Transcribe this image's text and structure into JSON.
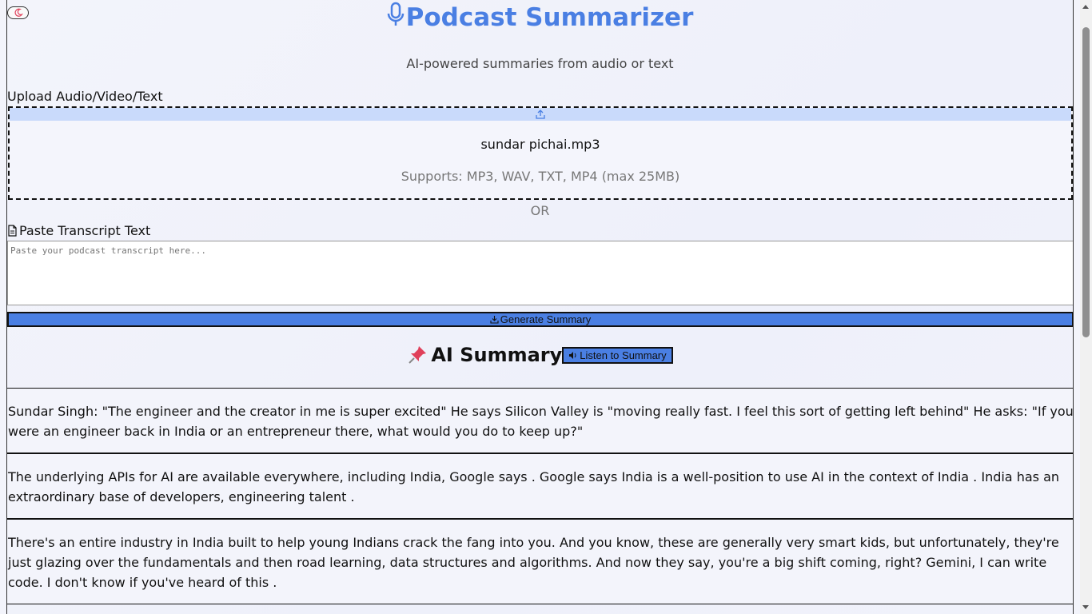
{
  "header": {
    "title": "Podcast Summarizer",
    "subtitle": "AI-powered summaries from audio or text"
  },
  "upload": {
    "label": "Upload Audio/Video/Text",
    "filename": "sundar pichai.mp3",
    "supports": "Supports: MP3, WAV, TXT, MP4 (max 25MB)"
  },
  "or_text": "OR",
  "transcript": {
    "label": "Paste Transcript Text",
    "placeholder": "Paste your podcast transcript here..."
  },
  "generate_button": "Generate Summary",
  "summary": {
    "heading": "AI Summary",
    "listen_button": "Listen to Summary",
    "paragraphs": [
      "Sundar Singh: \"The engineer and the creator in me is super excited\" He says Silicon Valley is \"moving really fast. I feel this sort of getting left behind\" He asks: \"If you were an engineer back in India or an entrepreneur there, what would you do to keep up?\"",
      "The underlying APIs for AI are available everywhere, including India, Google says . Google says India is a well-position to use AI in the context of India . India has an extraordinary base of developers, engineering talent .",
      "There's an entire industry in India built to help young Indians crack the fang into you. And you know, these are generally very smart kids, but unfortunately, they're just glazing over the fundamentals and then road learning, data structures and algorithms. And now they say, you're a big shift coming, right? Gemini, I can write code. I don't know if you've heard of this ."
    ]
  },
  "colors": {
    "accent": "#4a7fe3",
    "dropzone_bar": "#c9dafb",
    "background": "#f3f4fb"
  },
  "icons": {
    "theme": "moon-icon",
    "title": "microphone-icon",
    "upload": "upload-icon",
    "paste": "document-icon",
    "generate": "download-icon",
    "summary": "pushpin-icon",
    "listen": "speaker-icon"
  }
}
